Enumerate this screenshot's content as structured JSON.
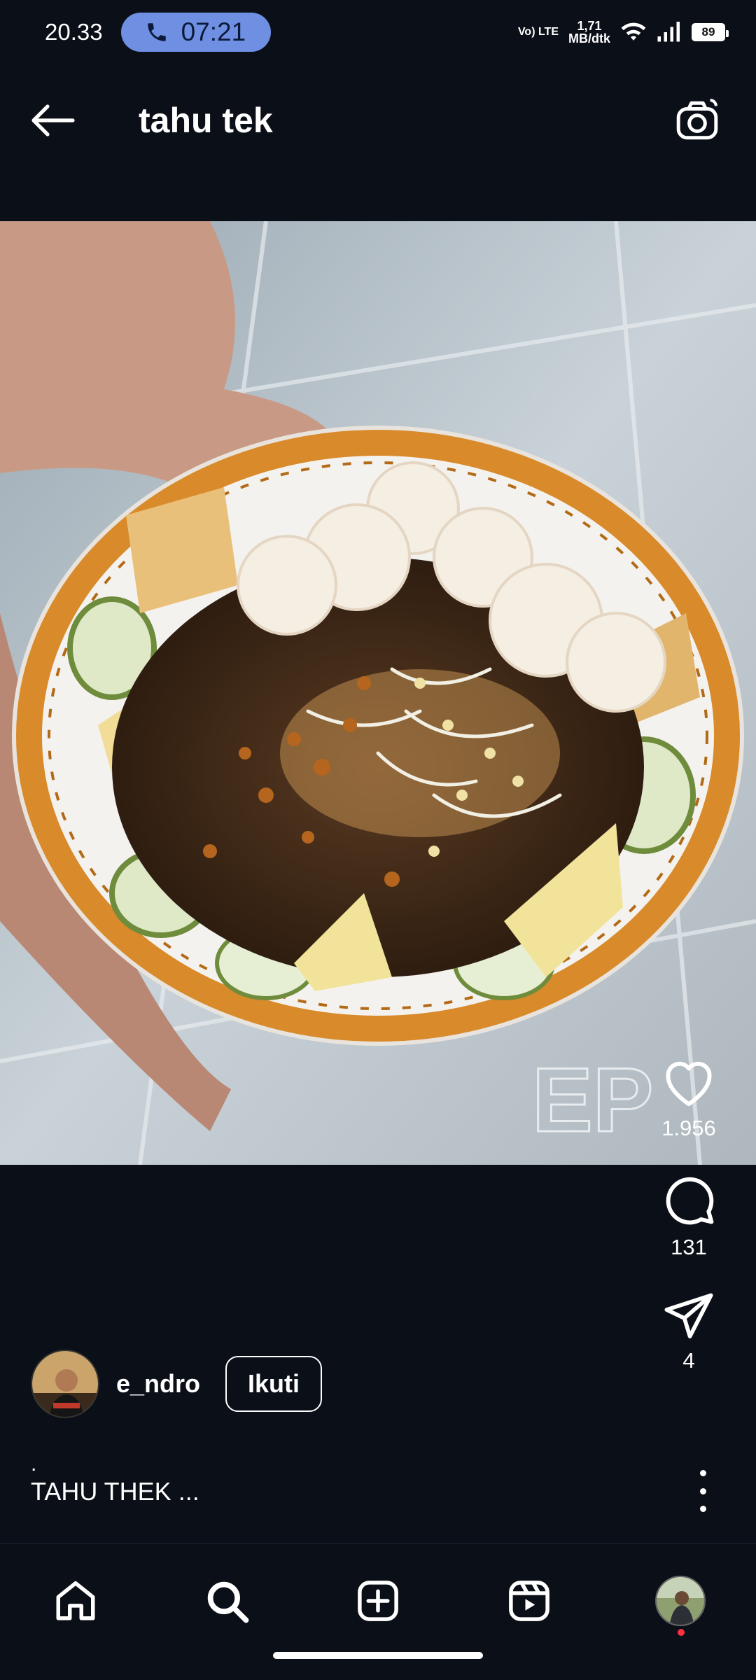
{
  "status_bar": {
    "time": "20.33",
    "call_timer": "07:21",
    "network_top": "Vo) LTE",
    "speed_value": "1,71",
    "speed_unit": "MB/dtk",
    "battery": "89"
  },
  "header": {
    "title": "tahu tek",
    "back_icon": "arrow-left-icon",
    "camera_icon": "camera-icon"
  },
  "media": {
    "watermark": "EP"
  },
  "actions": {
    "likes": "1.956",
    "comments": "131",
    "shares": "4"
  },
  "author": {
    "username": "e_ndro",
    "follow_label": "Ikuti"
  },
  "caption": {
    "dot": ".",
    "text": "TAHU THEK ..."
  },
  "nav": {
    "items": [
      "home-icon",
      "search-icon",
      "create-icon",
      "reels-icon",
      "profile-avatar"
    ]
  },
  "colors": {
    "background": "#0b0f17",
    "call_pill": "#6f8fe3",
    "notification": "#ff3040"
  }
}
